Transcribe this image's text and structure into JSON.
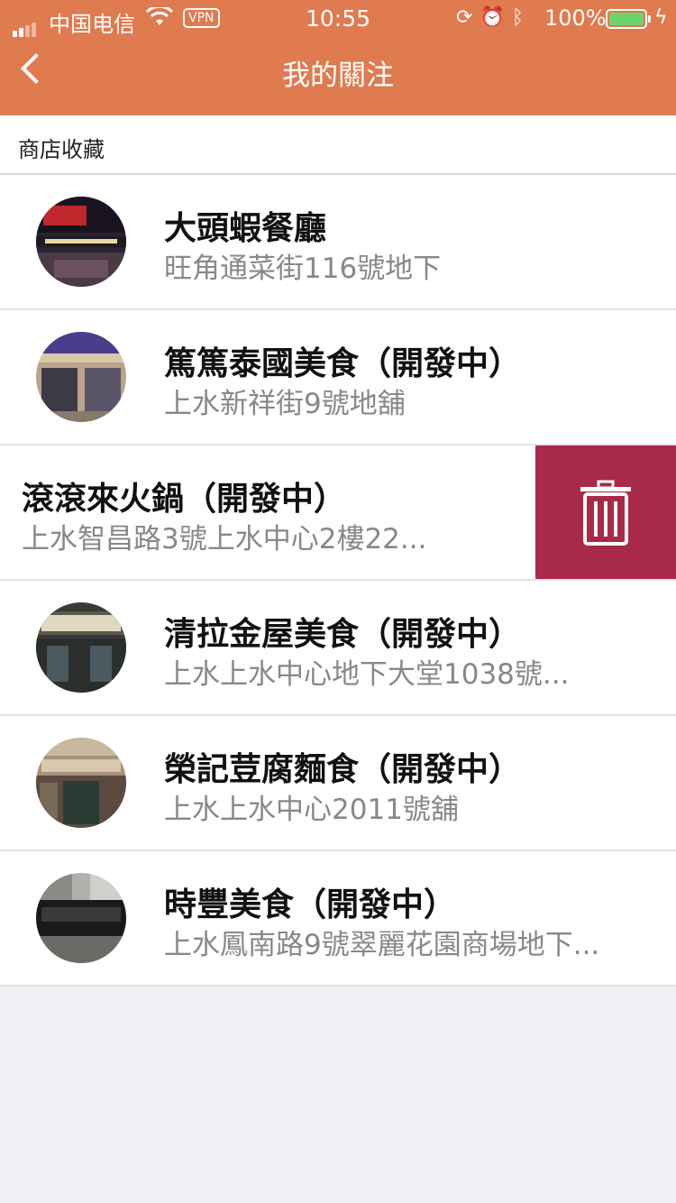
{
  "status_bar": {
    "carrier": "中国电信",
    "vpn": "VPN",
    "time": "10:55",
    "battery": "100%"
  },
  "nav": {
    "title": "我的關注",
    "back_icon": "chevron-left-icon"
  },
  "section": {
    "title": "商店收藏"
  },
  "colors": {
    "header": "#e07a4f",
    "delete": "#a82a48"
  },
  "stores": [
    {
      "name": "大頭蝦餐廳",
      "address": "旺角通菜街116號地下"
    },
    {
      "name": "篤篤泰國美食（開發中）",
      "address": "上水新祥街9號地舖"
    },
    {
      "name": "滾滾來火鍋（開發中）",
      "address": "上水智昌路3號上水中心2樓22..."
    },
    {
      "name": "清拉金屋美食（開發中）",
      "address": "上水上水中心地下大堂1038號..."
    },
    {
      "name": "榮記荳腐麵食（開發中）",
      "address": "上水上水中心2011號舖"
    },
    {
      "name": "時豐美食（開發中）",
      "address": "上水鳳南路9號翠麗花園商場地下..."
    }
  ]
}
